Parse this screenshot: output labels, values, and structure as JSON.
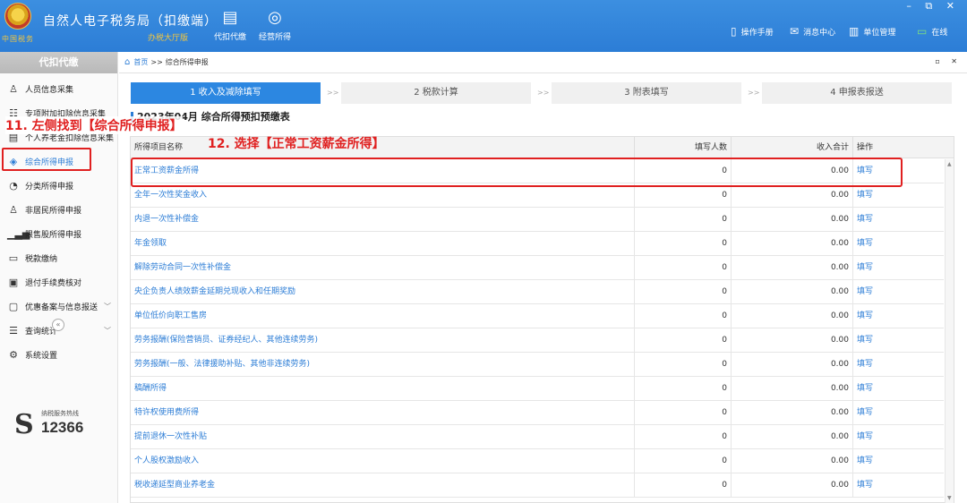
{
  "header": {
    "title": "自然人电子税务局（扣缴端）",
    "subtitle": "办税大厅版",
    "emblem_text": "中国税务",
    "nav": [
      {
        "label": "代扣代缴",
        "icon": "briefcase-icon"
      },
      {
        "label": "经营所得",
        "icon": "coins-icon"
      }
    ],
    "right_links": [
      {
        "label": "操作手册",
        "icon": "manual-icon"
      },
      {
        "label": "消息中心",
        "icon": "mail-icon"
      },
      {
        "label": "单位管理",
        "icon": "building-icon"
      },
      {
        "label": "在线",
        "icon": "monitor-icon"
      }
    ],
    "window_controls": "– ⧉ ✕"
  },
  "sidebar": {
    "title": "代扣代缴",
    "items": [
      {
        "label": "人员信息采集",
        "icon": "person-icon",
        "active": false,
        "expandable": false
      },
      {
        "label": "专项附加扣除信息采集",
        "icon": "list-icon",
        "active": false,
        "expandable": false
      },
      {
        "label": "个人养老金扣除信息采集",
        "icon": "document-icon",
        "active": false,
        "expandable": false
      },
      {
        "label": "综合所得申报",
        "icon": "layers-icon",
        "active": true,
        "expandable": false
      },
      {
        "label": "分类所得申报",
        "icon": "pie-chart-icon",
        "active": false,
        "expandable": false
      },
      {
        "label": "非居民所得申报",
        "icon": "person-outline-icon",
        "active": false,
        "expandable": false
      },
      {
        "label": "限售股所得申报",
        "icon": "bar-chart-icon",
        "active": false,
        "expandable": false
      },
      {
        "label": "税款缴纳",
        "icon": "wallet-icon",
        "active": false,
        "expandable": false
      },
      {
        "label": "退付手续费核对",
        "icon": "receipt-icon",
        "active": false,
        "expandable": false
      },
      {
        "label": "优惠备案与信息报送",
        "icon": "clipboard-icon",
        "active": false,
        "expandable": true
      },
      {
        "label": "查询统计",
        "icon": "search-list-icon",
        "active": false,
        "expandable": true
      },
      {
        "label": "系统设置",
        "icon": "gear-icon",
        "active": false,
        "expandable": false
      }
    ],
    "collapse_icon": "«",
    "hotline_label": "纳税服务热线",
    "hotline_number": "12366"
  },
  "breadcrumb": {
    "home": "首页",
    "sep": ">>",
    "current": "综合所得申报",
    "controls": "▫ ✕"
  },
  "steps": [
    {
      "label": "1 收入及减除填写",
      "active": true
    },
    {
      "label": "2 税款计算",
      "active": false
    },
    {
      "label": "3 附表填写",
      "active": false
    },
    {
      "label": "4 申报表报送",
      "active": false
    }
  ],
  "step_sep": ">>",
  "form_title": "2023年04月  综合所得预扣预缴表",
  "table": {
    "headers": [
      "所得项目名称",
      "填写人数",
      "收入合计",
      "操作"
    ],
    "rows": [
      {
        "name": "正常工资薪金所得",
        "count": "0",
        "total": "0.00",
        "op": "填写"
      },
      {
        "name": "全年一次性奖金收入",
        "count": "0",
        "total": "0.00",
        "op": "填写"
      },
      {
        "name": "内退一次性补偿金",
        "count": "0",
        "total": "0.00",
        "op": "填写"
      },
      {
        "name": "年金领取",
        "count": "0",
        "total": "0.00",
        "op": "填写"
      },
      {
        "name": "解除劳动合同一次性补偿金",
        "count": "0",
        "total": "0.00",
        "op": "填写"
      },
      {
        "name": "央企负责人绩效薪金延期兑现收入和任期奖励",
        "count": "0",
        "total": "0.00",
        "op": "填写"
      },
      {
        "name": "单位低价向职工售房",
        "count": "0",
        "total": "0.00",
        "op": "填写"
      },
      {
        "name": "劳务报酬(保险营销员、证券经纪人、其他连续劳务)",
        "count": "0",
        "total": "0.00",
        "op": "填写"
      },
      {
        "name": "劳务报酬(一般、法律援助补贴、其他非连续劳务)",
        "count": "0",
        "total": "0.00",
        "op": "填写"
      },
      {
        "name": "稿酬所得",
        "count": "0",
        "total": "0.00",
        "op": "填写"
      },
      {
        "name": "特许权使用费所得",
        "count": "0",
        "total": "0.00",
        "op": "填写"
      },
      {
        "name": "提前退休一次性补贴",
        "count": "0",
        "total": "0.00",
        "op": "填写"
      },
      {
        "name": "个人股权激励收入",
        "count": "0",
        "total": "0.00",
        "op": "填写"
      },
      {
        "name": "税收递延型商业养老金",
        "count": "0",
        "total": "0.00",
        "op": "填写"
      }
    ]
  },
  "annotations": {
    "callout_11": "11. 左侧找到【综合所得申报】",
    "callout_12": "12. 选择【正常工资薪金所得】"
  },
  "colors": {
    "primary": "#2c7dd6",
    "highlight": "#e02020",
    "gold": "#f3c63f"
  }
}
